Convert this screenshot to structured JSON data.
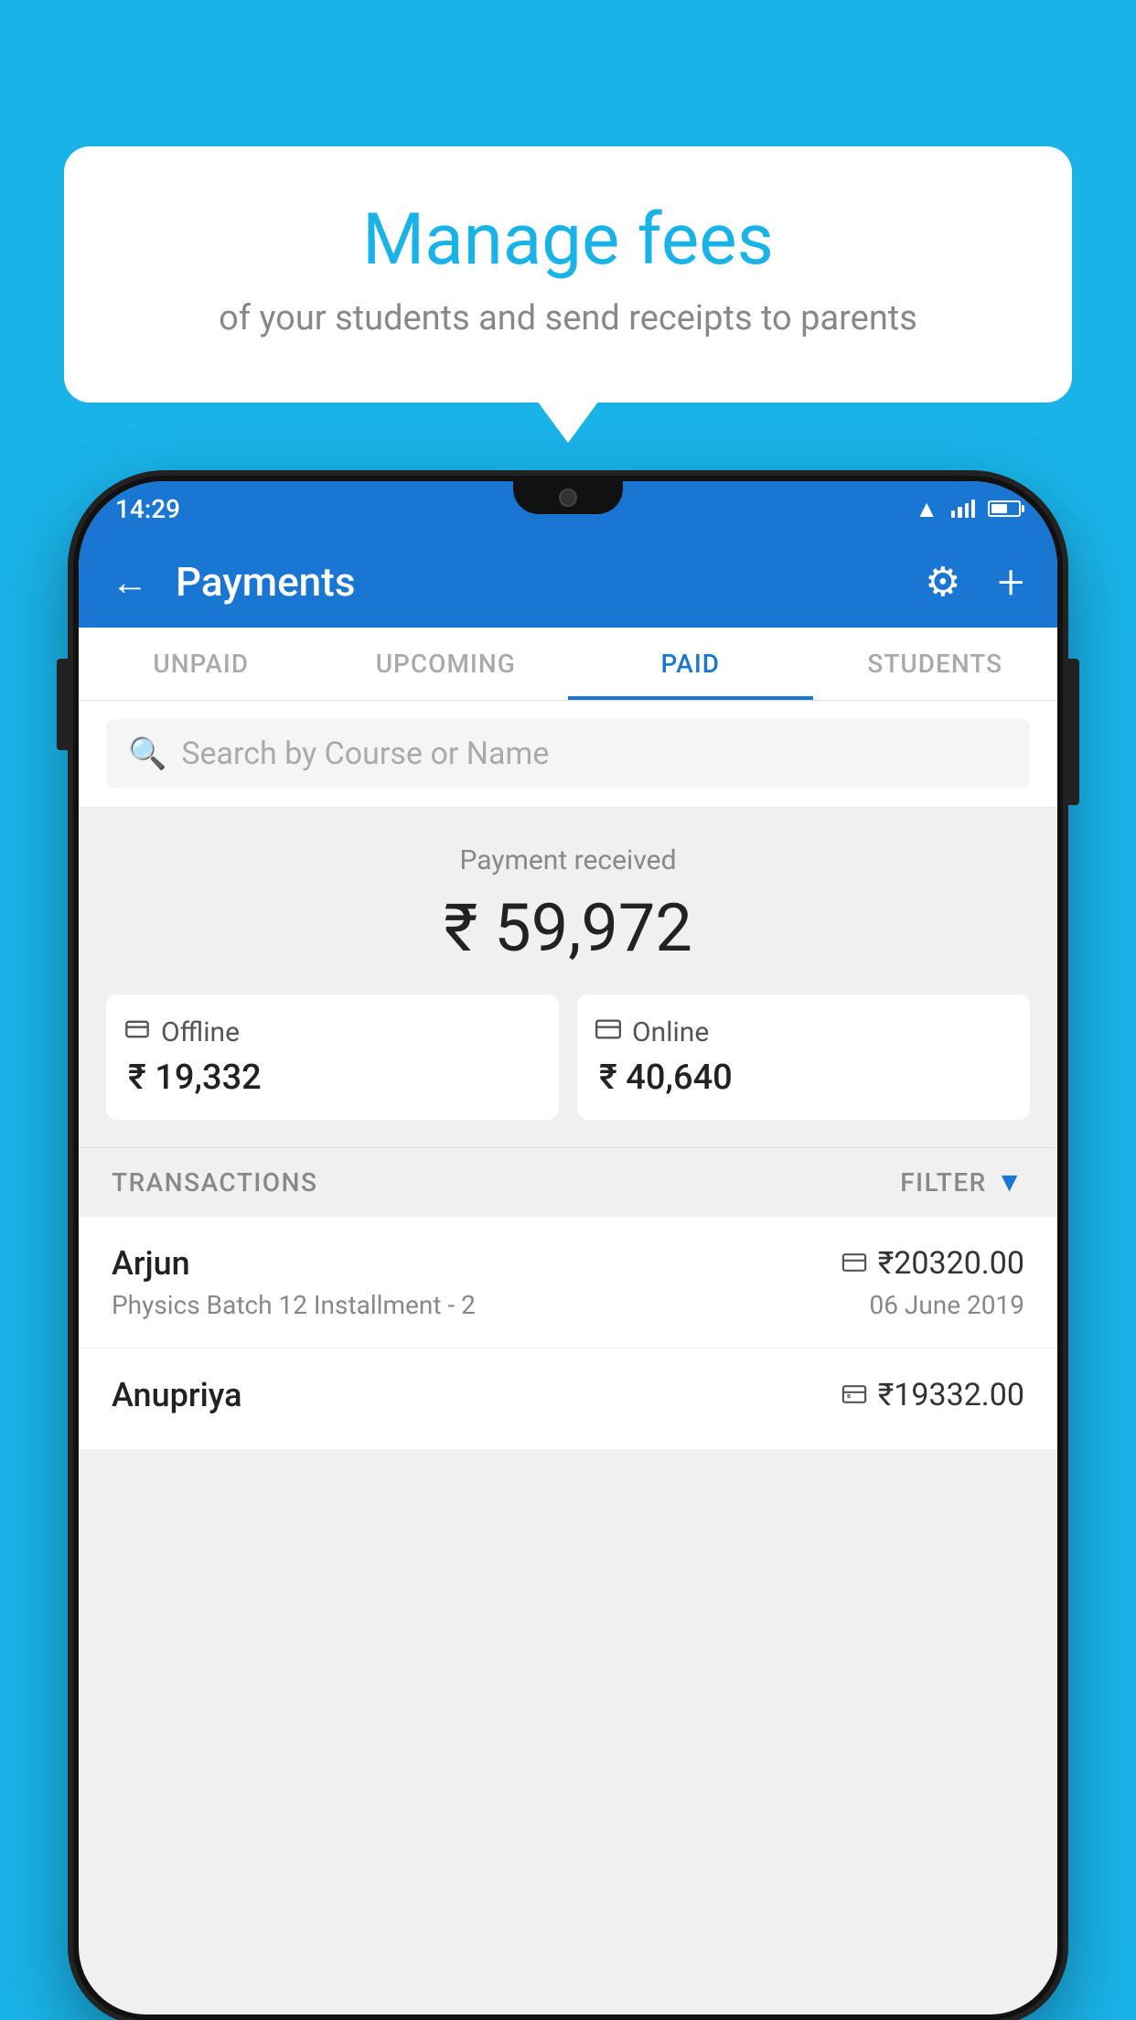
{
  "app_background": "#1ab3e8",
  "speech_bubble": {
    "title": "Manage fees",
    "subtitle": "of your students and send receipts to parents"
  },
  "status_bar": {
    "time": "14:29"
  },
  "header": {
    "title": "Payments",
    "back_label": "←",
    "gear_label": "⚙",
    "plus_label": "+"
  },
  "tabs": [
    {
      "label": "UNPAID",
      "active": false
    },
    {
      "label": "UPCOMING",
      "active": false
    },
    {
      "label": "PAID",
      "active": true
    },
    {
      "label": "STUDENTS",
      "active": false
    }
  ],
  "search": {
    "placeholder": "Search by Course or Name"
  },
  "payment_summary": {
    "label": "Payment received",
    "total": "₹ 59,972",
    "offline_label": "Offline",
    "offline_amount": "₹ 19,332",
    "online_label": "Online",
    "online_amount": "₹ 40,640"
  },
  "transactions": {
    "section_label": "TRANSACTIONS",
    "filter_label": "FILTER",
    "items": [
      {
        "name": "Arjun",
        "course": "Physics Batch 12 Installment - 2",
        "amount": "₹20320.00",
        "date": "06 June 2019",
        "mode": "online"
      },
      {
        "name": "Anupriya",
        "course": "",
        "amount": "₹19332.00",
        "date": "",
        "mode": "offline"
      }
    ]
  },
  "icons": {
    "search": "🔍",
    "back_arrow": "←",
    "gear": "⚙",
    "plus": "+",
    "filter_funnel": "▼",
    "offline_payment": "₹",
    "online_payment": "💳",
    "wifi": "▲",
    "battery": "▮"
  }
}
